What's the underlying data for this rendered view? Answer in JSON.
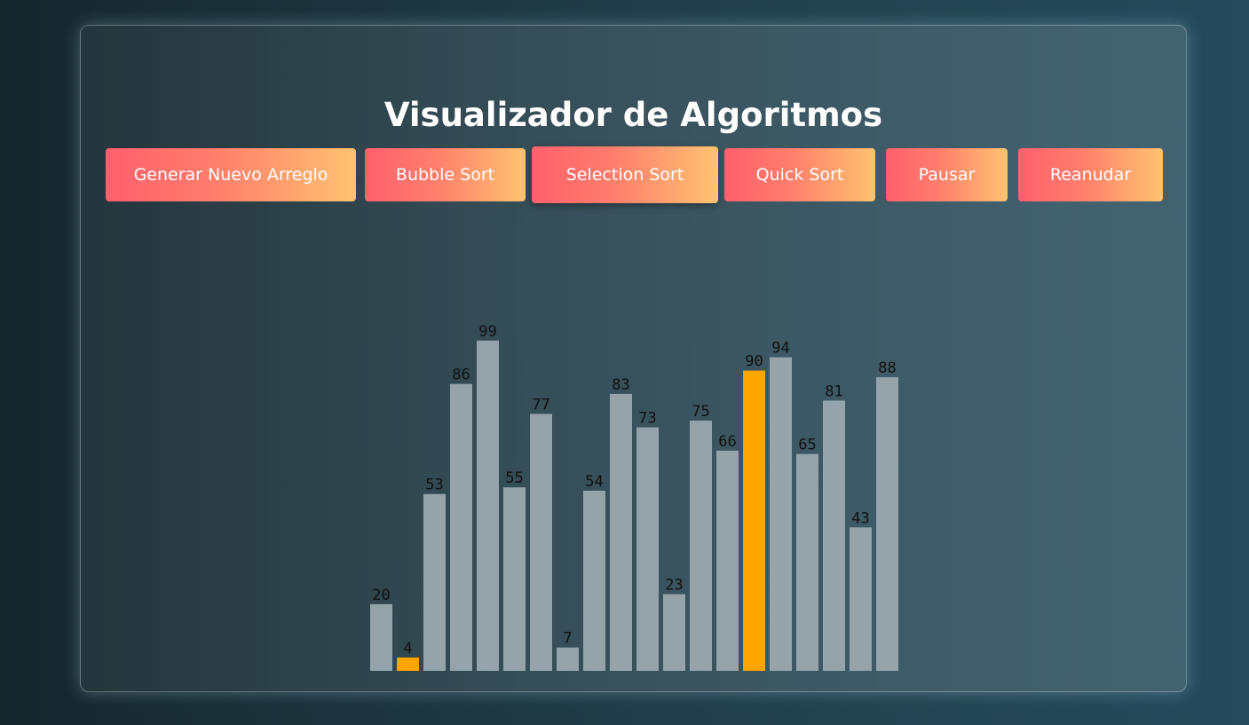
{
  "page": {
    "title": "Visualizador de Algoritmos"
  },
  "buttons": [
    {
      "label": "Generar Nuevo Arreglo"
    },
    {
      "label": "Bubble Sort"
    },
    {
      "label": "Selection Sort"
    },
    {
      "label": "Quick Sort"
    },
    {
      "label": "Pausar"
    },
    {
      "label": "Reanudar"
    }
  ],
  "colors": {
    "bar_default": "#95a3aa",
    "bar_highlight": "#ffa500",
    "button_gradient_start": "#ff5f6d",
    "button_gradient_end": "#ffc371"
  },
  "chart_data": {
    "type": "bar",
    "values": [
      20,
      4,
      53,
      86,
      99,
      55,
      77,
      7,
      54,
      83,
      73,
      23,
      75,
      66,
      90,
      94,
      65,
      81,
      43,
      88
    ],
    "highlighted_indices": [
      1,
      14
    ]
  }
}
